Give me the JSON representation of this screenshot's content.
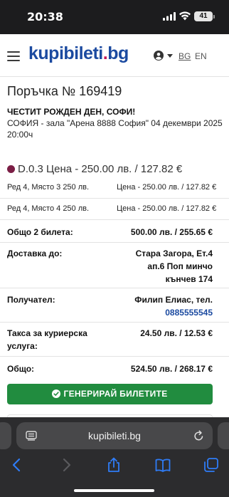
{
  "status_bar": {
    "time": "20:38",
    "battery": "41"
  },
  "header": {
    "logo_main": "kupibileti",
    "logo_dot": ".",
    "logo_tld": "bg",
    "lang_bg": "BG",
    "lang_en": "EN"
  },
  "order": {
    "title": "Поръчка № 169419",
    "greeting": "ЧЕСТИТ РОЖДЕН ДЕН, СОФИ!",
    "venue": "СОФИЯ - зала \"Арена 8888 София\" 04 декември 2025 20:00ч",
    "zone": "D.0.3 Цена - 250.00 лв. / 127.82 €",
    "zone_color": "#7b1e45",
    "tickets": [
      {
        "seat": "Ред 4, Място 3 250 лв.",
        "price": "Цена - 250.00 лв. / 127.82 €"
      },
      {
        "seat": "Ред 4, Място 4 250 лв.",
        "price": "Цена - 250.00 лв. / 127.82 €"
      }
    ],
    "total_tickets": {
      "label": "Общо 2 билета:",
      "value": "500.00 лв. / 255.65 €"
    },
    "delivery": {
      "label": "Доставка до:",
      "line1": "Стара Загора, Ет.4",
      "line2": "ап.6 Поп минчо",
      "line3": "кънчев 174"
    },
    "recipient": {
      "label": "Получател:",
      "name": "Филип Елиас, тел.",
      "phone": "0885555545"
    },
    "courier_fee": {
      "label_line1": "Такса за куриерска",
      "label_line2": "услуга:",
      "value": "24.50 лв. / 12.53 €"
    },
    "grand_total": {
      "label": "Общо:",
      "value": "524.50 лв. / 268.17 €"
    },
    "generate_button": "ГЕНЕРИРАЙ БИЛЕТИТЕ",
    "accent_color": "#218c3f"
  },
  "browser": {
    "url": "kupibileti.bg"
  }
}
